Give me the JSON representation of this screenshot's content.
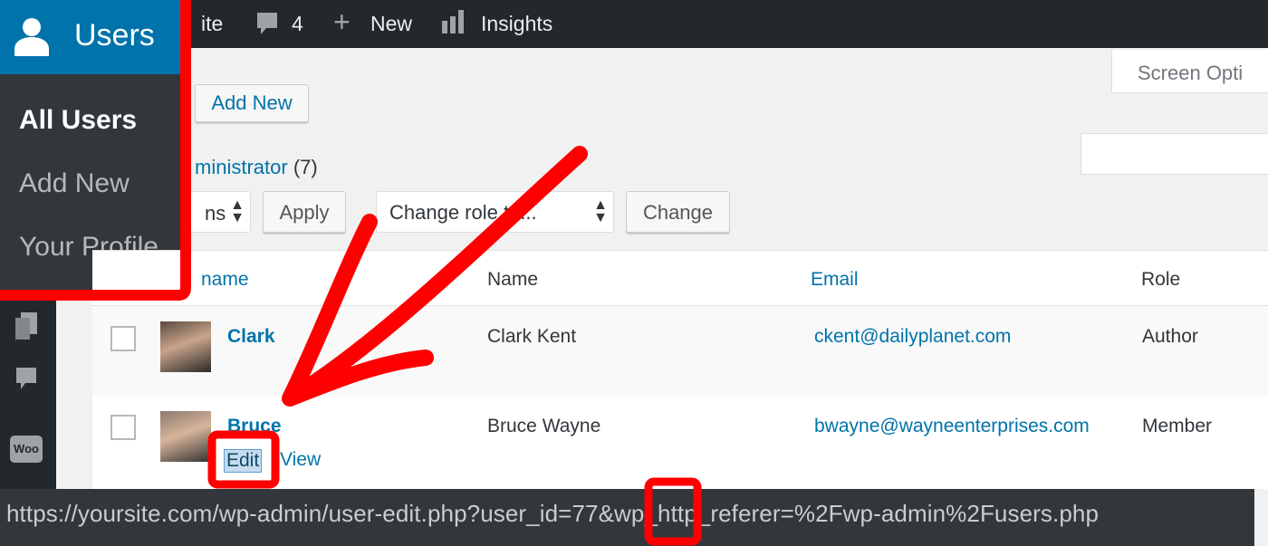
{
  "topbar": {
    "site": "ite",
    "comments_count": "4",
    "new_label": "New",
    "insights_label": "Insights"
  },
  "sidebar": {
    "section": "Users",
    "items": [
      {
        "label": "All Users",
        "active": true
      },
      {
        "label": "Add New"
      },
      {
        "label": "Your Profile"
      }
    ],
    "icons": [
      "pages-icon",
      "comments-icon",
      "woocommerce-icon"
    ],
    "woo_label": "Woo"
  },
  "header": {
    "add_new": "Add New",
    "screen_options": "Screen Opti"
  },
  "filters": {
    "administrator": "ministrator",
    "administrator_count": "(7)"
  },
  "bulk": {
    "actions_value": "ns",
    "apply": "Apply",
    "change_role_value": "Change role to...",
    "change": "Change"
  },
  "table": {
    "columns": [
      "name",
      "Name",
      "Email",
      "Role"
    ],
    "rows": [
      {
        "username": "Clark",
        "name": "Clark Kent",
        "email": "ckent@dailyplanet.com",
        "role": "Author"
      },
      {
        "username": "Bruce",
        "name": "Bruce Wayne",
        "email": "bwayne@wayneenterprises.com",
        "role": "Member",
        "actions": [
          "Edit",
          "View"
        ]
      }
    ]
  },
  "status_url": "https://yoursite.com/wp-admin/user-edit.php?user_id=77&wp_http_referer=%2Fwp-admin%2Fusers.php",
  "colors": {
    "accent": "#0073aa",
    "annotation": "#ff0000",
    "adminbar": "#23282d"
  }
}
